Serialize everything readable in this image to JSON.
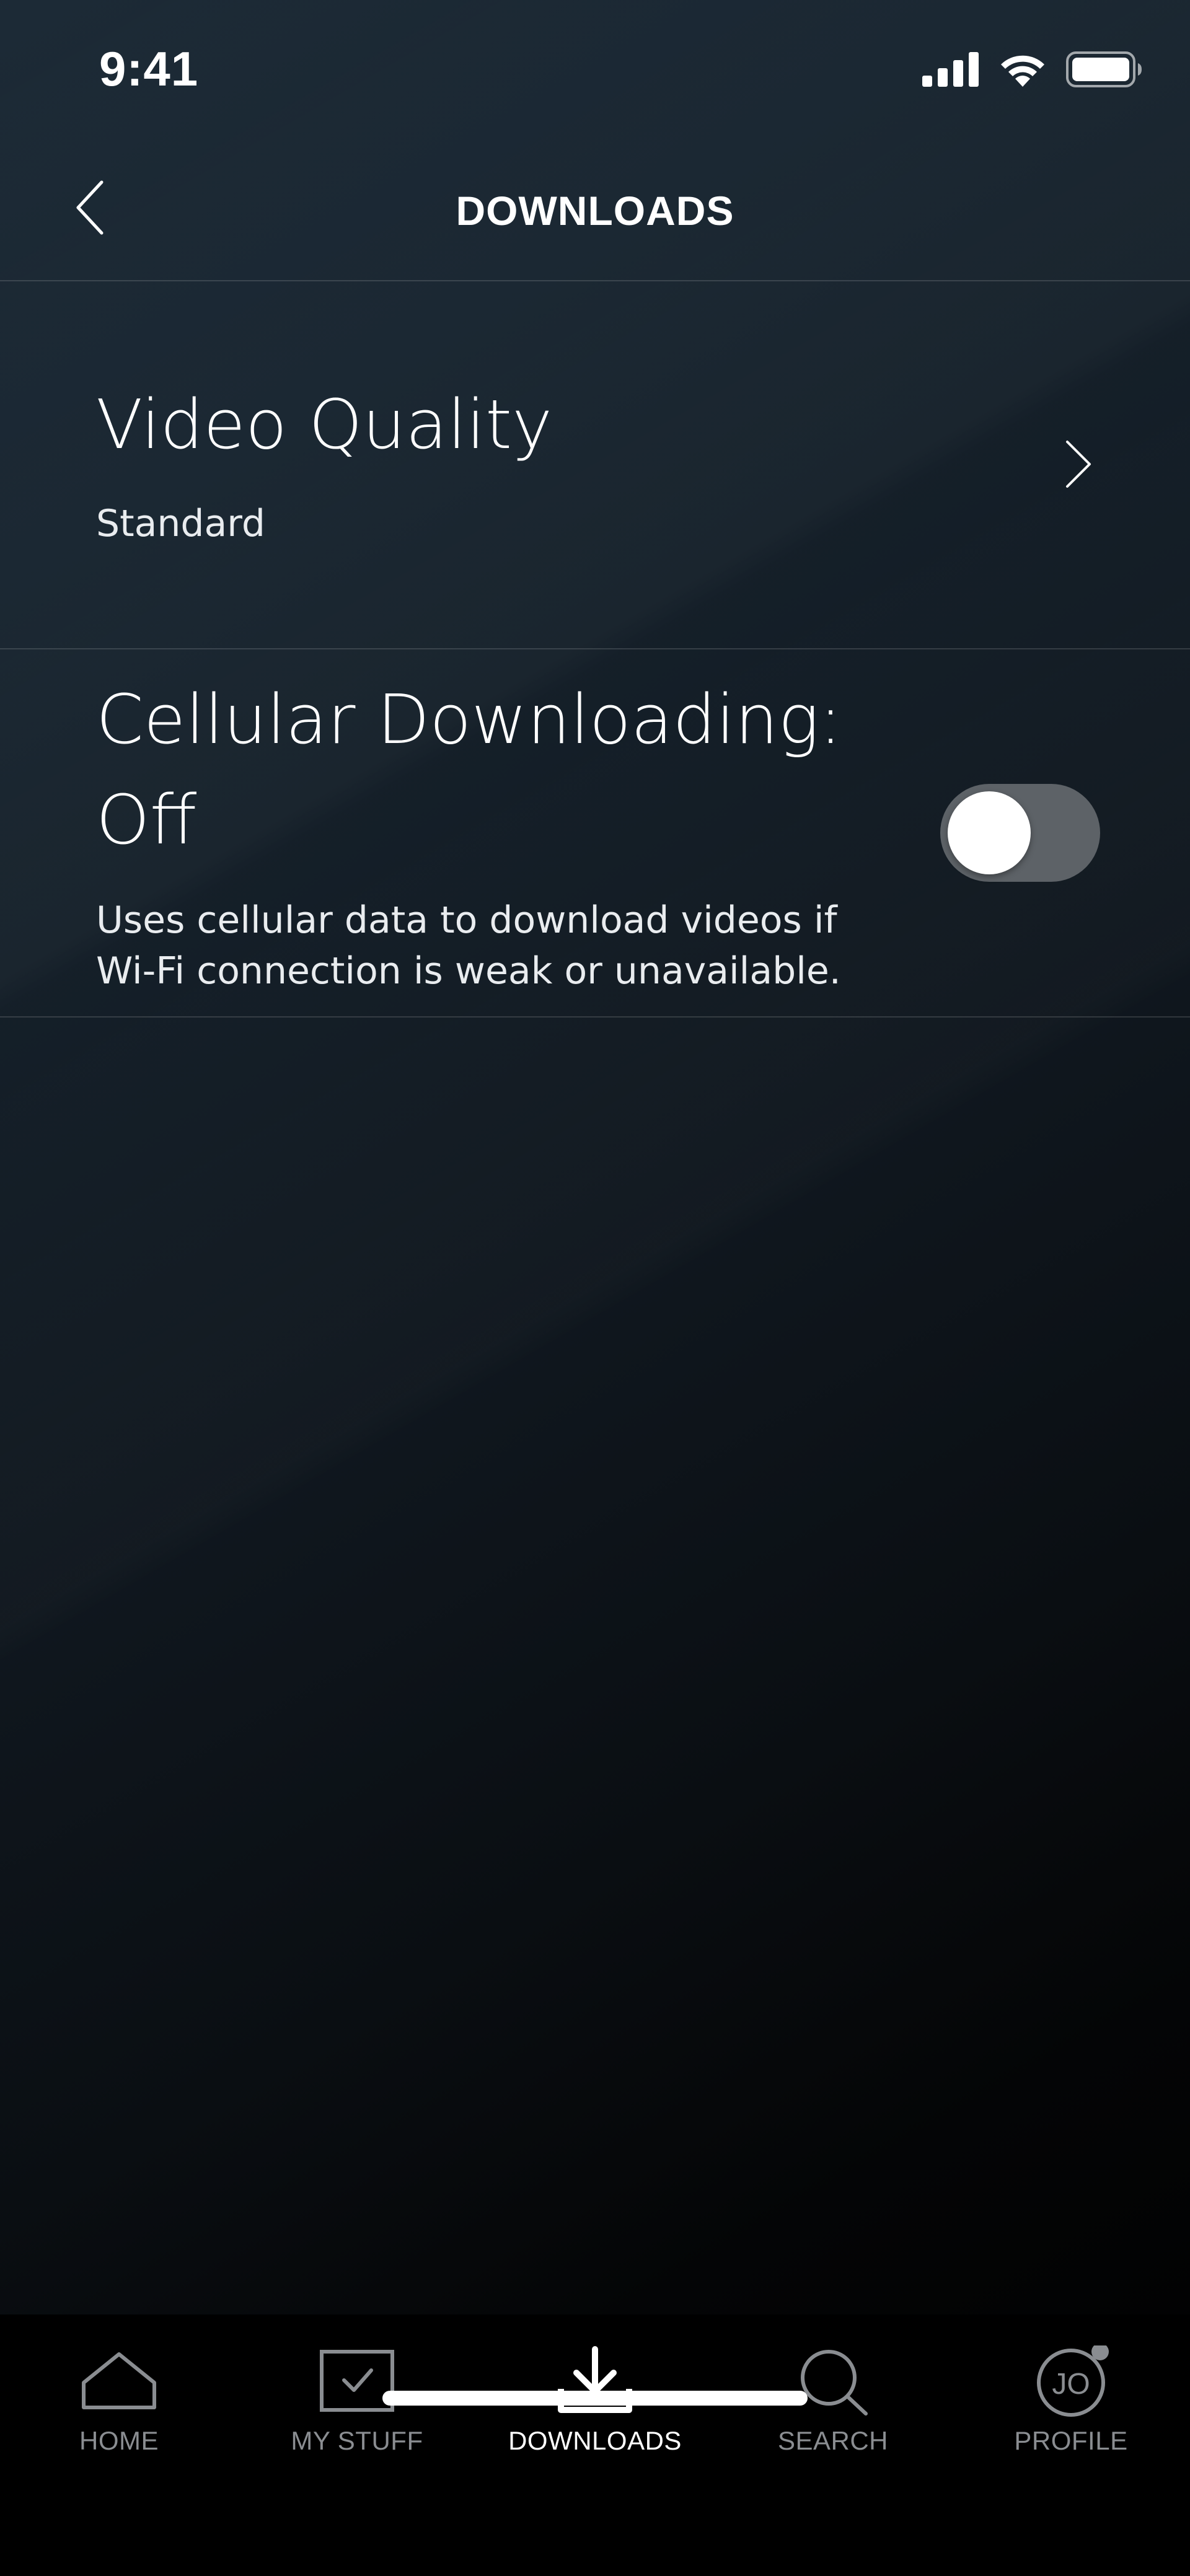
{
  "status_bar": {
    "time": "9:41",
    "icons": [
      "signal-icon",
      "wifi-icon",
      "battery-icon"
    ]
  },
  "header": {
    "title": "DOWNLOADS",
    "back_icon": "chevron-left-icon"
  },
  "settings": {
    "video_quality": {
      "title": "Video Quality",
      "value": "Standard",
      "icon": "chevron-right-icon"
    },
    "cellular_downloading": {
      "title": "Cellular Downloading: Off",
      "description": "Uses cellular data to download videos if Wi-Fi connection is weak or unavailable.",
      "toggle_on": false
    }
  },
  "bottom_nav": {
    "items": [
      {
        "label": "HOME",
        "icon": "home-icon",
        "active": false
      },
      {
        "label": "MY STUFF",
        "icon": "my-stuff-icon",
        "active": false
      },
      {
        "label": "DOWNLOADS",
        "icon": "download-icon",
        "active": true
      },
      {
        "label": "SEARCH",
        "icon": "search-icon",
        "active": false
      },
      {
        "label": "PROFILE",
        "icon": "profile-avatar-icon",
        "avatar_initials": "JO",
        "active": false
      }
    ]
  },
  "colors": {
    "background_top": "#1c2a36",
    "background_bottom": "#000000",
    "toggle_track_off": "#5d6267",
    "nav_inactive": "#8a8d91",
    "nav_active": "#ffffff"
  }
}
